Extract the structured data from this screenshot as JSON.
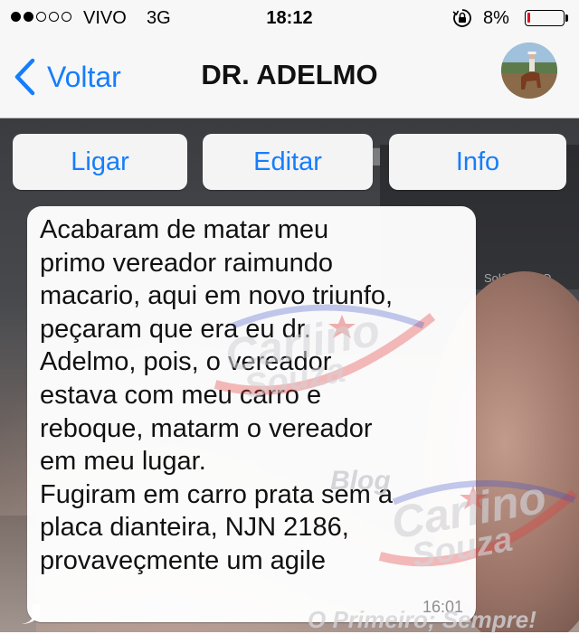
{
  "status_bar": {
    "signal_bars_filled": 2,
    "signal_bars_total": 5,
    "carrier": "VIVO",
    "network": "3G",
    "time": "18:12",
    "battery_percent": "8%",
    "battery_level": 0.08,
    "battery_color": "#e11122"
  },
  "nav": {
    "back_label": "Voltar",
    "title": "DR. ADELMO",
    "accent_color": "#157efb"
  },
  "actions": {
    "call_label": "Ligar",
    "edit_label": "Editar",
    "info_label": "Info"
  },
  "message": {
    "lines": [
      "Acabaram de matar meu",
      "primo vereador raimundo",
      "macario, aqui em novo triunfo,",
      "peçaram que era eu dr.",
      "Adelmo, pois, o vereador",
      "estava com meu carro e",
      "reboque, matarm o vereador",
      "em meu lugar.",
      "Fugiram em carro prata sem a",
      "placa dianteira, NJN 2186,",
      "provaveçmente um agile"
    ],
    "time": "16:01"
  },
  "wallpaper": {
    "caption": "Solânia / GO"
  },
  "watermark": {
    "brand_line1": "Carlino",
    "brand_line2": "Souza",
    "blog": "Blog",
    "slogan": "O Primeiro; Sempre!"
  }
}
